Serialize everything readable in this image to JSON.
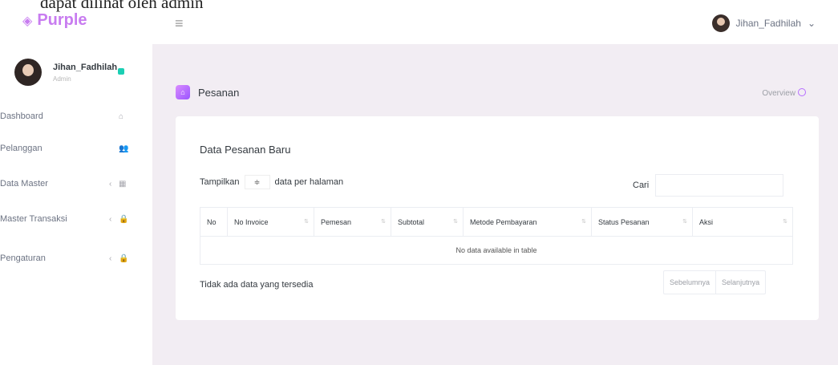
{
  "caption": "dapat dilihat oleh admin",
  "brand": {
    "name": "Purple"
  },
  "topbar": {
    "username": "Jihan_Fadhilah",
    "caret": "⌄"
  },
  "sidebar": {
    "profile": {
      "name": "Jihan_Fadhilah",
      "role": "Admin"
    },
    "items": [
      {
        "label": "Dashboard",
        "icon": "home-icon",
        "glyph": "⌂",
        "chevron": ""
      },
      {
        "label": "Pelanggan",
        "icon": "users-icon",
        "glyph": "👥",
        "chevron": ""
      },
      {
        "label": "Data Master",
        "icon": "table-icon",
        "glyph": "▦",
        "chevron": "‹"
      },
      {
        "label": "Master Transaksi",
        "icon": "lock-icon",
        "glyph": "🔒",
        "chevron": "‹"
      },
      {
        "label": "Pengaturan",
        "icon": "lock-icon",
        "glyph": "🔒",
        "chevron": "‹"
      }
    ]
  },
  "page": {
    "title": "Pesanan",
    "overview": "Overview"
  },
  "card": {
    "title": "Data Pesanan Baru",
    "length_prefix": "Tampilkan",
    "length_suffix": "data per halaman",
    "length_value": "≑",
    "search_label": "Cari",
    "columns": [
      "No",
      "No Invoice",
      "Pemesan",
      "Subtotal",
      "Metode Pembayaran",
      "Status Pesanan",
      "Aksi"
    ],
    "empty_message": "No data available in table",
    "info": "Tidak ada data yang tersedia",
    "prev": "Sebelumnya",
    "next": "Selanjutnya"
  },
  "colors": {
    "accent": "#b66dff",
    "brand": "#c87cf0",
    "background": "#f2edf3"
  }
}
